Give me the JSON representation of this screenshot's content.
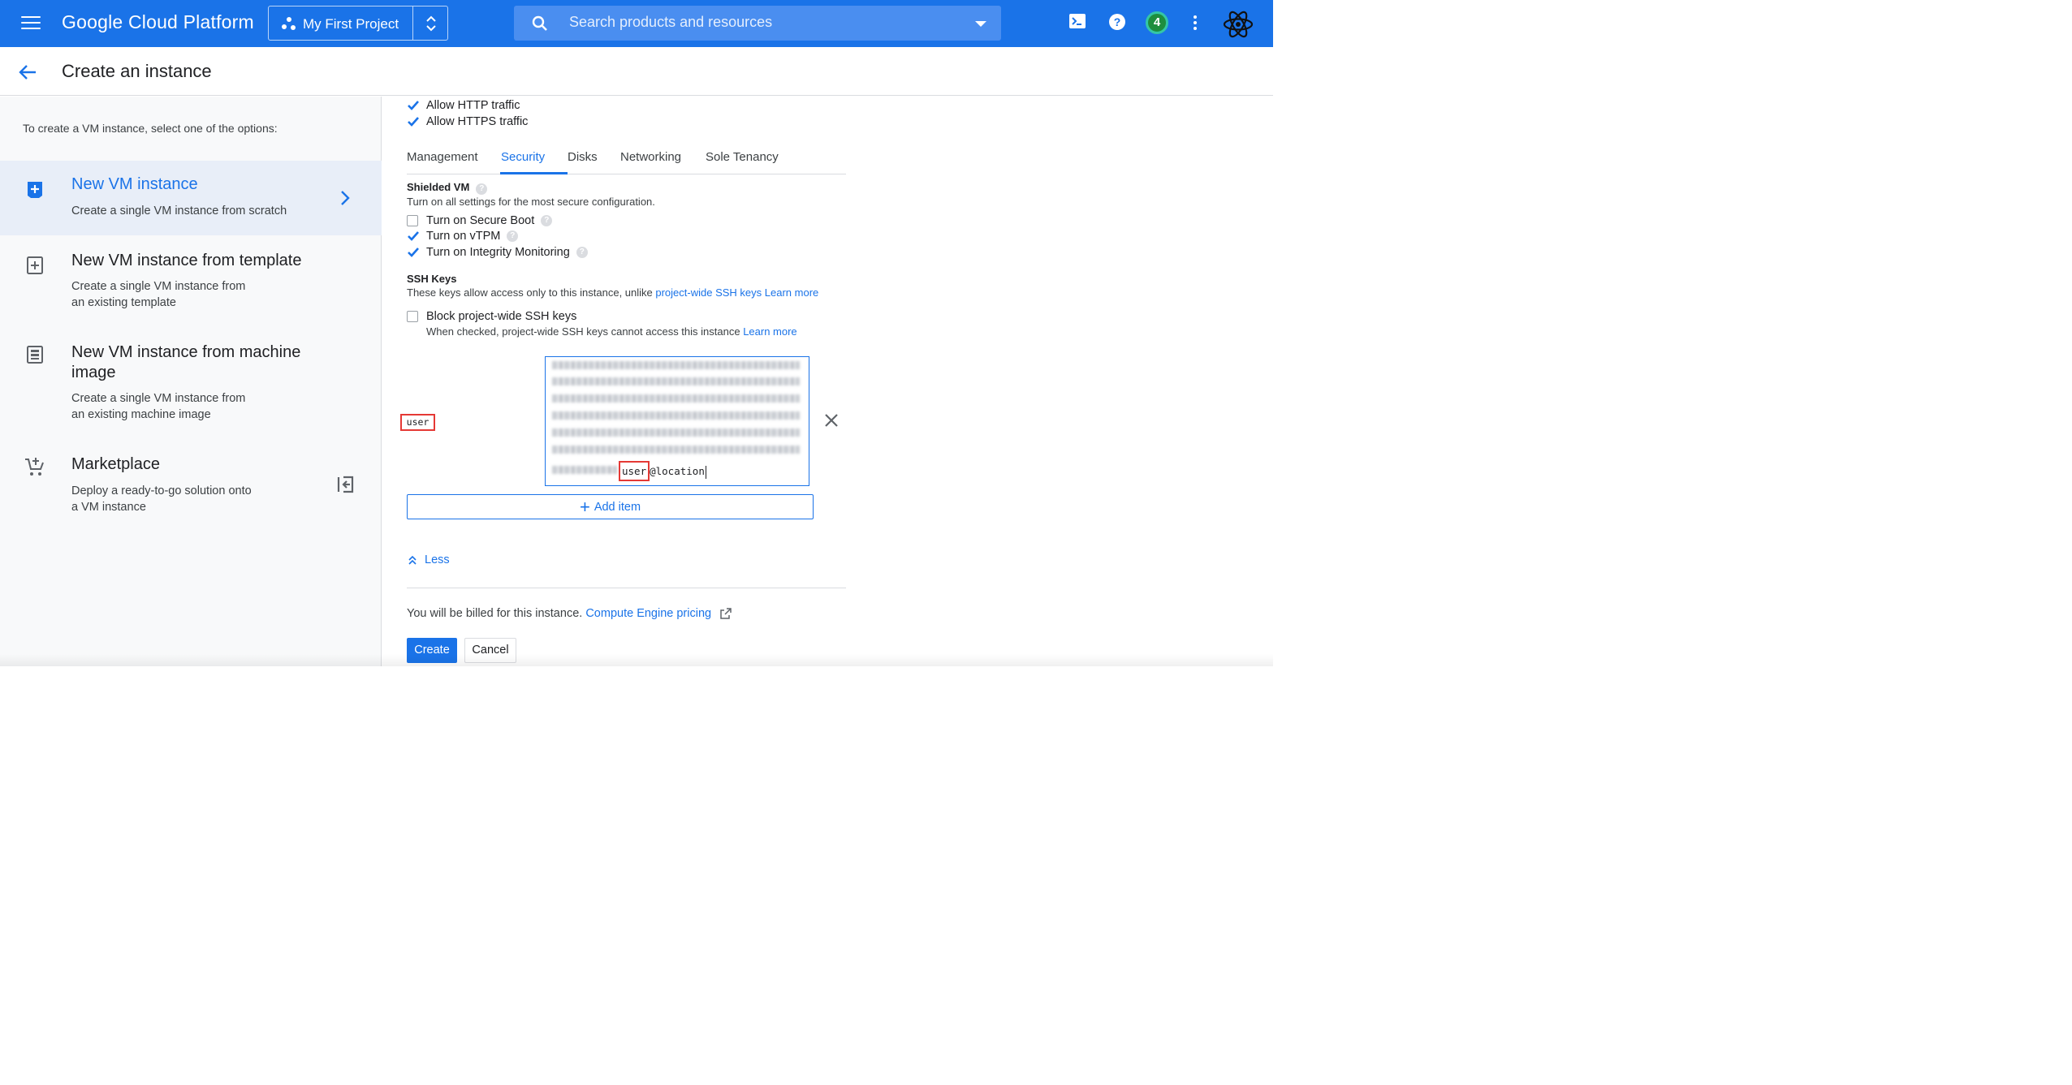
{
  "app": {
    "brand": "Google Cloud Platform",
    "project_name": "My First Project",
    "search_placeholder": "Search products and resources",
    "notification_count": "4",
    "accent_color": "#1a73e8"
  },
  "header": {
    "title": "Create an instance"
  },
  "sidebar": {
    "intro": "To create a VM instance, select one of the options:",
    "options": [
      {
        "title": "New VM instance",
        "desc": "Create a single VM instance from scratch",
        "selected": true,
        "icon": "add-box-icon"
      },
      {
        "title": "New VM instance from template",
        "desc_line1": "Create a single VM instance from",
        "desc_line2": "an existing template",
        "icon": "template-icon"
      },
      {
        "title_line1": "New VM instance from machine",
        "title_line2": "image",
        "desc_line1": "Create a single VM instance from",
        "desc_line2": "an existing machine image",
        "icon": "machine-image-icon"
      },
      {
        "title": "Marketplace",
        "desc_line1": "Deploy a ready-to-go solution onto",
        "desc_line2": "a VM instance",
        "icon": "cart-icon"
      }
    ]
  },
  "firewall": {
    "http": {
      "label": "Allow HTTP traffic",
      "checked": true
    },
    "https": {
      "label": "Allow HTTPS traffic",
      "checked": true
    }
  },
  "tabs": [
    "Management",
    "Security",
    "Disks",
    "Networking",
    "Sole Tenancy"
  ],
  "active_tab": "Security",
  "shielded_vm": {
    "title": "Shielded VM",
    "desc": "Turn on all settings for the most secure configuration.",
    "secure_boot": {
      "label": "Turn on Secure Boot",
      "checked": false
    },
    "vtpm": {
      "label": "Turn on vTPM",
      "checked": true
    },
    "integrity": {
      "label": "Turn on Integrity Monitoring",
      "checked": true
    }
  },
  "ssh_keys": {
    "title": "SSH Keys",
    "desc": "These keys allow access only to this instance, unlike ",
    "desc_link": "project-wide SSH keys",
    "learn_more": "Learn more",
    "block_label": "Block project-wide SSH keys",
    "block_checked": false,
    "block_desc": "When checked, project-wide SSH keys cannot access this instance ",
    "key_user": "user",
    "key_suffix_user": "user",
    "key_suffix_rest": "@location",
    "add_item": "Add item"
  },
  "less_label": "Less",
  "billing": {
    "text": "You will be billed for this instance. ",
    "link": "Compute Engine pricing"
  },
  "buttons": {
    "create": "Create",
    "cancel": "Cancel"
  }
}
